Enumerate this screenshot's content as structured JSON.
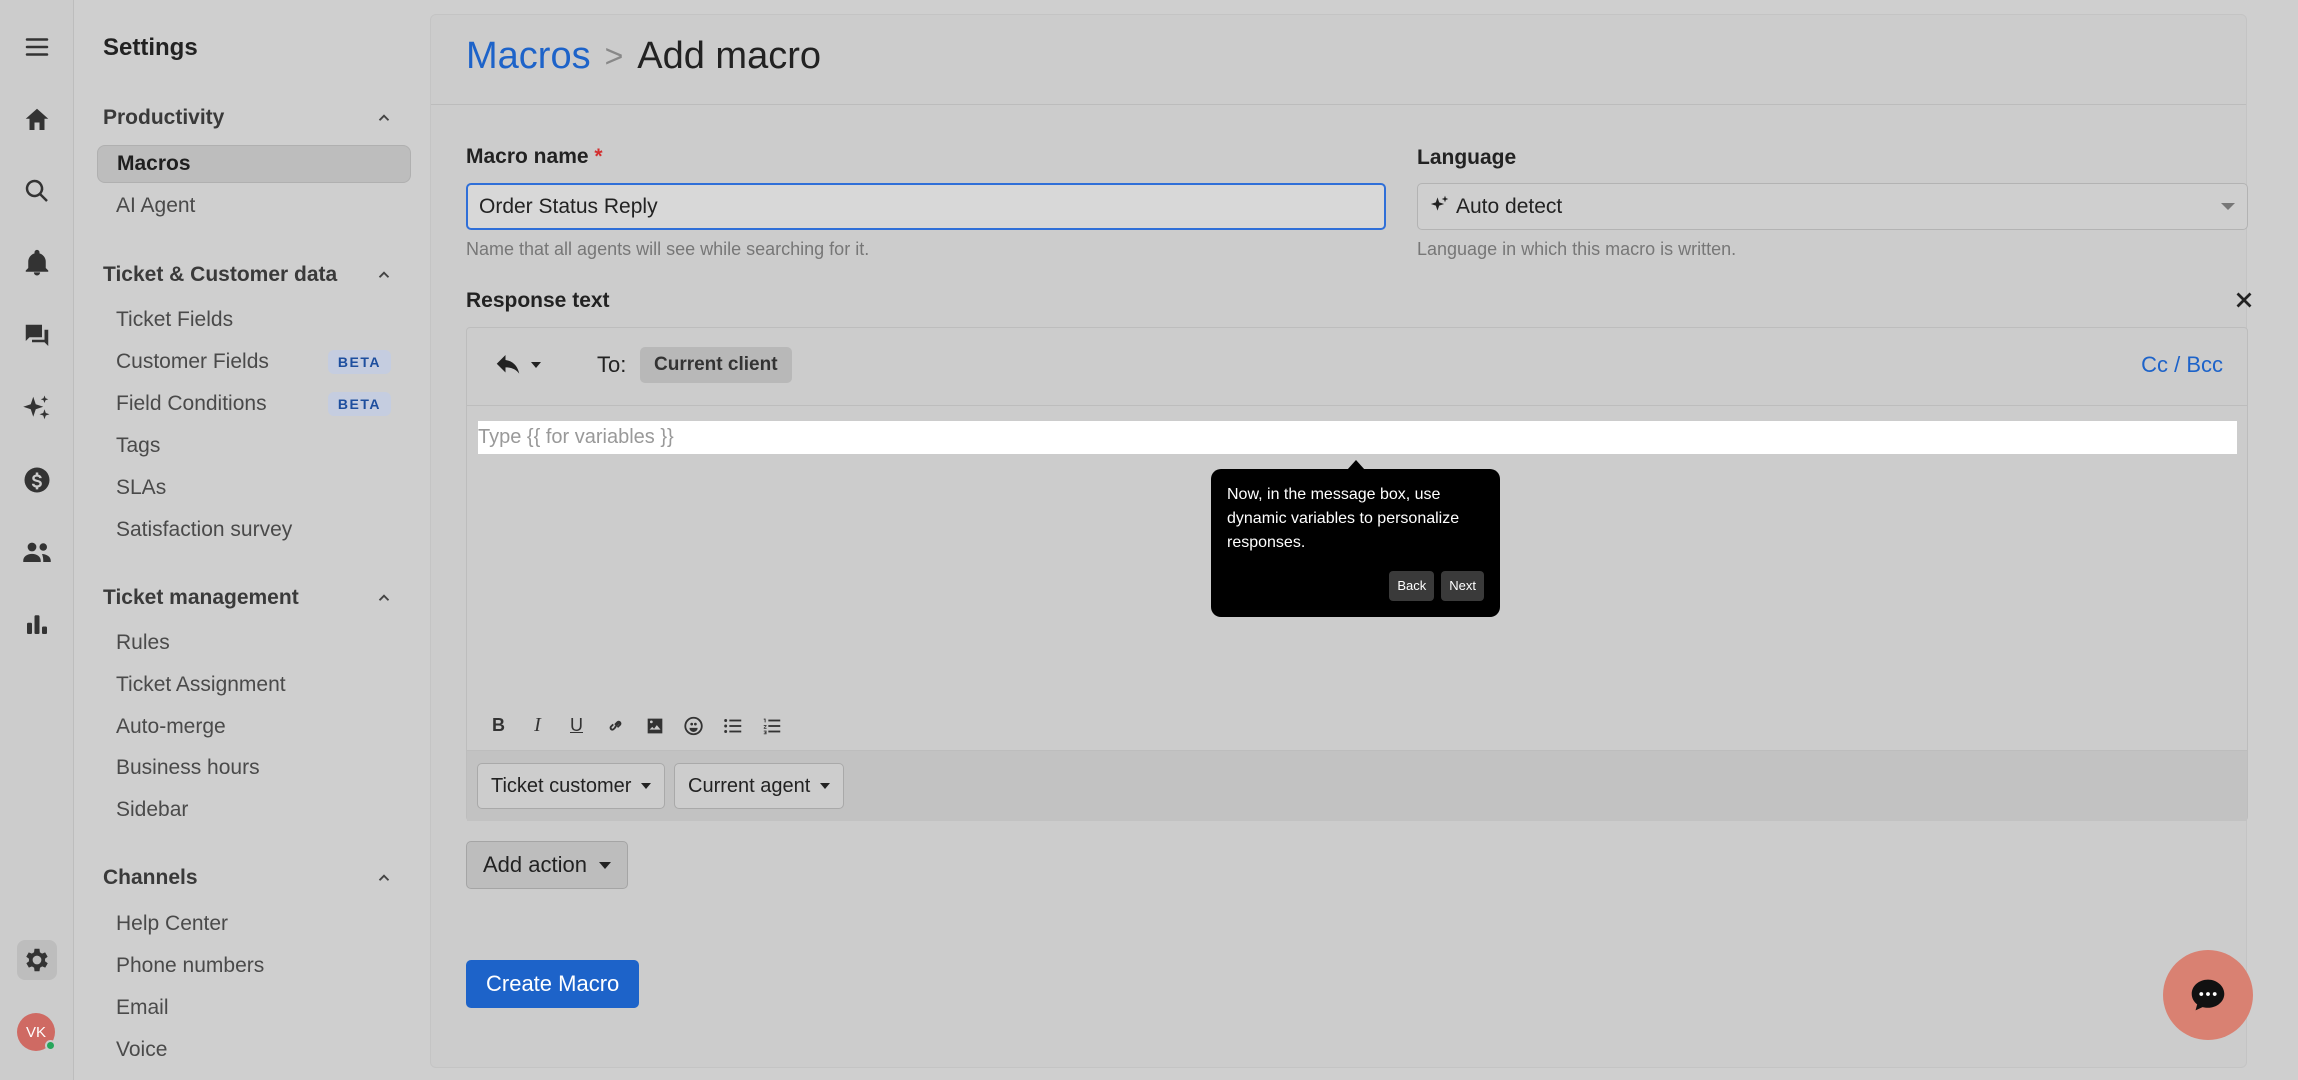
{
  "rail": {
    "icons": [
      "menu-icon",
      "home-icon",
      "search-icon",
      "bell-icon",
      "chat-icon",
      "sparkle-icon",
      "dollar-icon",
      "people-icon",
      "chart-icon",
      "gear-icon"
    ],
    "avatar_initials": "VK"
  },
  "sidebar": {
    "title": "Settings",
    "sections": [
      {
        "label": "Productivity",
        "items": [
          "Macros",
          "AI Agent"
        ]
      },
      {
        "label": "Ticket & Customer data",
        "items": [
          "Ticket Fields",
          "Customer Fields",
          "Field Conditions",
          "Tags",
          "SLAs",
          "Satisfaction survey"
        ]
      },
      {
        "label": "Ticket management",
        "items": [
          "Rules",
          "Ticket Assignment",
          "Auto-merge",
          "Business hours",
          "Sidebar"
        ]
      },
      {
        "label": "Channels",
        "items": [
          "Help Center",
          "Phone numbers",
          "Email",
          "Voice"
        ]
      }
    ],
    "beta_badge": "BETA",
    "active_item": "Macros"
  },
  "header": {
    "breadcrumb_link": "Macros",
    "breadcrumb_sep": ">",
    "breadcrumb_current": "Add macro"
  },
  "form": {
    "macro_name_label": "Macro name",
    "required_mark": "*",
    "macro_name_value": "Order Status Reply",
    "macro_name_help": "Name that all agents will see while searching for it.",
    "language_label": "Language",
    "language_value": "Auto detect",
    "language_help": "Language in which this macro is written.",
    "response_label": "Response text"
  },
  "editor": {
    "to_label": "To:",
    "recipient_chip": "Current client",
    "cc_bcc": "Cc / Bcc",
    "placeholder": "Type {{ for variables }}",
    "variables": [
      "Ticket customer",
      "Current agent"
    ]
  },
  "actions": {
    "add_action": "Add action",
    "create": "Create Macro"
  },
  "tooltip": {
    "text": "Now, in the message box, use dynamic variables to personalize responses.",
    "back": "Back",
    "next": "Next"
  },
  "colors": {
    "accent": "#1d63c9",
    "chat_bubble": "#d98172",
    "required": "#d32f2f"
  }
}
